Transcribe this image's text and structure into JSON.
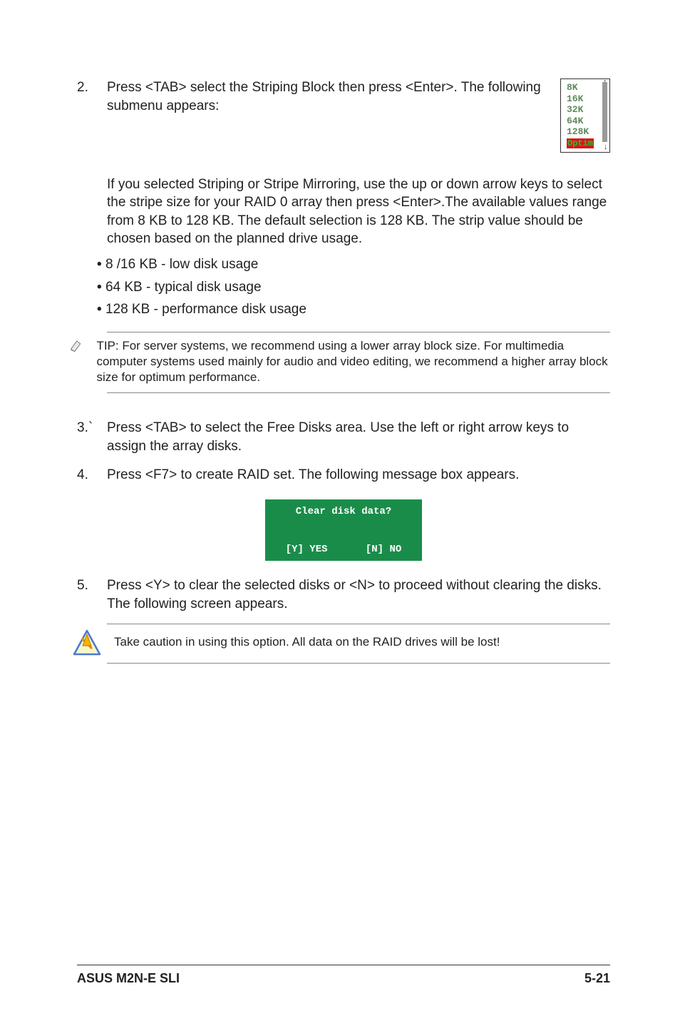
{
  "step2": {
    "num": "2.",
    "text": "Press <TAB> select the Striping Block then press <Enter>. The following submenu appears:"
  },
  "submenu": {
    "items": [
      " 8K",
      " 16K",
      " 32K",
      " 64K",
      " 128K"
    ],
    "selected": "Optim"
  },
  "explain": "If you selected Striping or Stripe Mirroring, use the up or down arrow keys to select the stripe size for your RAID 0 array then press <Enter>.The available values range from 8 KB to 128 KB. The default selection is 128 KB. The strip value should be chosen based on the planned drive usage.",
  "bullets": [
    "8 /16 KB - low disk usage",
    "64 KB - typical disk usage",
    "128 KB - performance disk usage"
  ],
  "tip": "TIP: For server systems, we recommend using a lower array block size. For multimedia computer systems used mainly for audio and video editing, we recommend a higher array block size for optimum performance.",
  "step3": {
    "num": "3.`",
    "text": "Press <TAB> to select the Free Disks area. Use the left or right arrow keys to assign the array disks."
  },
  "step4": {
    "num": "4.",
    "text": "Press <F7> to create RAID set. The following message box appears."
  },
  "dialog": {
    "title": "Clear disk data?",
    "yes": "[Y] YES",
    "no": "[N] NO"
  },
  "step5": {
    "num": "5.",
    "text": "Press <Y> to clear the selected disks or <N> to proceed without clearing the disks. The following screen appears."
  },
  "warn": "Take caution in using this option. All data on the RAID drives will be lost!",
  "footer": {
    "left": "ASUS M2N-E SLI",
    "right": "5-21"
  }
}
